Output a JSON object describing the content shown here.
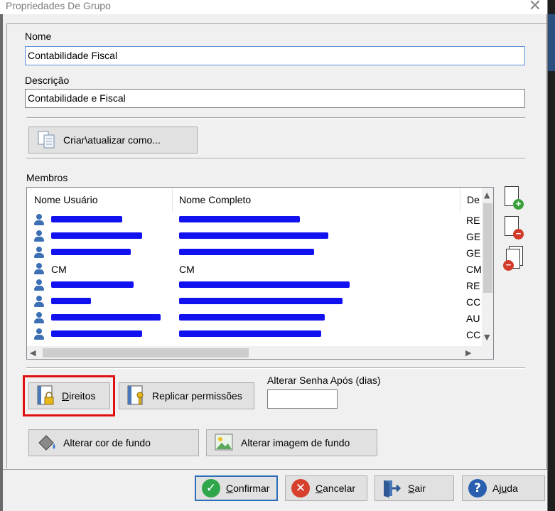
{
  "window": {
    "title": "Propriedades De Grupo",
    "close_glyph": "✕"
  },
  "form": {
    "nome_label": "Nome",
    "nome_value": "Contabilidade Fiscal",
    "descricao_label": "Descrição",
    "descricao_value": "Contabilidade e Fiscal",
    "create_update_button": "Criar\\atualizar como..."
  },
  "members": {
    "label": "Membros",
    "columns": [
      "Nome Usuário",
      "Nome Completo",
      "De"
    ],
    "rows": [
      {
        "user": "",
        "full": "",
        "dept": "RE",
        "redacted": true
      },
      {
        "user": "",
        "full": "",
        "dept": "GE",
        "redacted": true
      },
      {
        "user": "",
        "full": "",
        "dept": "GE",
        "redacted": true
      },
      {
        "user": "CM",
        "full": "CM",
        "dept": "CM",
        "redacted": false
      },
      {
        "user": "",
        "full": "",
        "dept": "RE",
        "redacted": true
      },
      {
        "user": "",
        "full": "",
        "dept": "CC",
        "redacted": true
      },
      {
        "user": "",
        "full": "",
        "dept": "AU",
        "redacted": true
      },
      {
        "user": "",
        "full": "",
        "dept": "CC",
        "redacted": true
      }
    ],
    "side_buttons": [
      "add-member-icon",
      "remove-member-icon",
      "remove-all-members-icon"
    ]
  },
  "actions": {
    "direitos_prefix": "D",
    "direitos_rest": "ireitos",
    "replicar_label": "Replicar permissões",
    "senha_label": "Alterar Senha Após (dias)",
    "senha_value": "",
    "cor_label": "Alterar cor de fundo",
    "imagem_label": "Alterar imagem de fundo"
  },
  "dialog_buttons": {
    "confirmar_prefix": "C",
    "confirmar_rest": "onfirmar",
    "cancelar_prefix": "C",
    "cancelar_rest": "ancelar",
    "sair_prefix": "S",
    "sair_rest": "air",
    "ajuda_prefix": "Aj",
    "ajuda_u": "u",
    "ajuda_rest": "da"
  },
  "colors": {
    "accent": "#2a6fb8",
    "highlight": "#e01010",
    "redaction": "#1212f0"
  }
}
